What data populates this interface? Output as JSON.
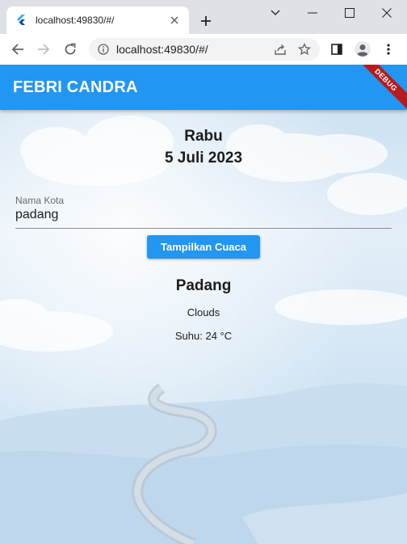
{
  "browser": {
    "tab_title": "localhost:49830/#/",
    "url": "localhost:49830/#/"
  },
  "icons": [
    "flutter-favicon-icon",
    "close-icon",
    "plus-icon",
    "chevron-down-icon",
    "minimize-icon",
    "maximize-icon",
    "close-window-icon",
    "back-icon",
    "forward-icon",
    "reload-icon",
    "info-icon",
    "share-icon",
    "star-icon",
    "sidepanel-icon",
    "profile-icon",
    "more-icon"
  ],
  "appbar": {
    "title": "FEBRI CANDRA",
    "debug_banner": "DEBUG"
  },
  "weather": {
    "day": "Rabu",
    "date": "5 Juli 2023",
    "input_label": "Nama Kota",
    "input_value": "padang",
    "button_label": "Tampilkan Cuaca",
    "city": "Padang",
    "condition": "Clouds",
    "temperature": "Suhu: 24 °C"
  },
  "colors": {
    "primary": "#2196f3",
    "debug": "#b71c1c",
    "chrome_bg": "#dee1e6"
  }
}
